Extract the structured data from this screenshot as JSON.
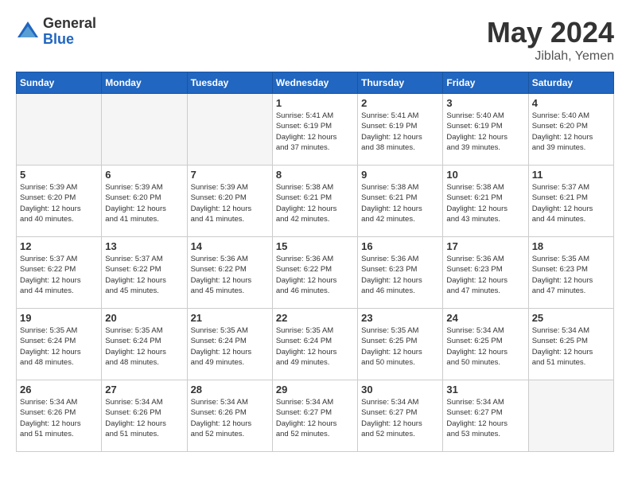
{
  "header": {
    "logo_general": "General",
    "logo_blue": "Blue",
    "month_year": "May 2024",
    "location": "Jiblah, Yemen"
  },
  "days_of_week": [
    "Sunday",
    "Monday",
    "Tuesday",
    "Wednesday",
    "Thursday",
    "Friday",
    "Saturday"
  ],
  "weeks": [
    [
      {
        "day": "",
        "info": ""
      },
      {
        "day": "",
        "info": ""
      },
      {
        "day": "",
        "info": ""
      },
      {
        "day": "1",
        "info": "Sunrise: 5:41 AM\nSunset: 6:19 PM\nDaylight: 12 hours\nand 37 minutes."
      },
      {
        "day": "2",
        "info": "Sunrise: 5:41 AM\nSunset: 6:19 PM\nDaylight: 12 hours\nand 38 minutes."
      },
      {
        "day": "3",
        "info": "Sunrise: 5:40 AM\nSunset: 6:19 PM\nDaylight: 12 hours\nand 39 minutes."
      },
      {
        "day": "4",
        "info": "Sunrise: 5:40 AM\nSunset: 6:20 PM\nDaylight: 12 hours\nand 39 minutes."
      }
    ],
    [
      {
        "day": "5",
        "info": "Sunrise: 5:39 AM\nSunset: 6:20 PM\nDaylight: 12 hours\nand 40 minutes."
      },
      {
        "day": "6",
        "info": "Sunrise: 5:39 AM\nSunset: 6:20 PM\nDaylight: 12 hours\nand 41 minutes."
      },
      {
        "day": "7",
        "info": "Sunrise: 5:39 AM\nSunset: 6:20 PM\nDaylight: 12 hours\nand 41 minutes."
      },
      {
        "day": "8",
        "info": "Sunrise: 5:38 AM\nSunset: 6:21 PM\nDaylight: 12 hours\nand 42 minutes."
      },
      {
        "day": "9",
        "info": "Sunrise: 5:38 AM\nSunset: 6:21 PM\nDaylight: 12 hours\nand 42 minutes."
      },
      {
        "day": "10",
        "info": "Sunrise: 5:38 AM\nSunset: 6:21 PM\nDaylight: 12 hours\nand 43 minutes."
      },
      {
        "day": "11",
        "info": "Sunrise: 5:37 AM\nSunset: 6:21 PM\nDaylight: 12 hours\nand 44 minutes."
      }
    ],
    [
      {
        "day": "12",
        "info": "Sunrise: 5:37 AM\nSunset: 6:22 PM\nDaylight: 12 hours\nand 44 minutes."
      },
      {
        "day": "13",
        "info": "Sunrise: 5:37 AM\nSunset: 6:22 PM\nDaylight: 12 hours\nand 45 minutes."
      },
      {
        "day": "14",
        "info": "Sunrise: 5:36 AM\nSunset: 6:22 PM\nDaylight: 12 hours\nand 45 minutes."
      },
      {
        "day": "15",
        "info": "Sunrise: 5:36 AM\nSunset: 6:22 PM\nDaylight: 12 hours\nand 46 minutes."
      },
      {
        "day": "16",
        "info": "Sunrise: 5:36 AM\nSunset: 6:23 PM\nDaylight: 12 hours\nand 46 minutes."
      },
      {
        "day": "17",
        "info": "Sunrise: 5:36 AM\nSunset: 6:23 PM\nDaylight: 12 hours\nand 47 minutes."
      },
      {
        "day": "18",
        "info": "Sunrise: 5:35 AM\nSunset: 6:23 PM\nDaylight: 12 hours\nand 47 minutes."
      }
    ],
    [
      {
        "day": "19",
        "info": "Sunrise: 5:35 AM\nSunset: 6:24 PM\nDaylight: 12 hours\nand 48 minutes."
      },
      {
        "day": "20",
        "info": "Sunrise: 5:35 AM\nSunset: 6:24 PM\nDaylight: 12 hours\nand 48 minutes."
      },
      {
        "day": "21",
        "info": "Sunrise: 5:35 AM\nSunset: 6:24 PM\nDaylight: 12 hours\nand 49 minutes."
      },
      {
        "day": "22",
        "info": "Sunrise: 5:35 AM\nSunset: 6:24 PM\nDaylight: 12 hours\nand 49 minutes."
      },
      {
        "day": "23",
        "info": "Sunrise: 5:35 AM\nSunset: 6:25 PM\nDaylight: 12 hours\nand 50 minutes."
      },
      {
        "day": "24",
        "info": "Sunrise: 5:34 AM\nSunset: 6:25 PM\nDaylight: 12 hours\nand 50 minutes."
      },
      {
        "day": "25",
        "info": "Sunrise: 5:34 AM\nSunset: 6:25 PM\nDaylight: 12 hours\nand 51 minutes."
      }
    ],
    [
      {
        "day": "26",
        "info": "Sunrise: 5:34 AM\nSunset: 6:26 PM\nDaylight: 12 hours\nand 51 minutes."
      },
      {
        "day": "27",
        "info": "Sunrise: 5:34 AM\nSunset: 6:26 PM\nDaylight: 12 hours\nand 51 minutes."
      },
      {
        "day": "28",
        "info": "Sunrise: 5:34 AM\nSunset: 6:26 PM\nDaylight: 12 hours\nand 52 minutes."
      },
      {
        "day": "29",
        "info": "Sunrise: 5:34 AM\nSunset: 6:27 PM\nDaylight: 12 hours\nand 52 minutes."
      },
      {
        "day": "30",
        "info": "Sunrise: 5:34 AM\nSunset: 6:27 PM\nDaylight: 12 hours\nand 52 minutes."
      },
      {
        "day": "31",
        "info": "Sunrise: 5:34 AM\nSunset: 6:27 PM\nDaylight: 12 hours\nand 53 minutes."
      },
      {
        "day": "",
        "info": ""
      }
    ]
  ]
}
